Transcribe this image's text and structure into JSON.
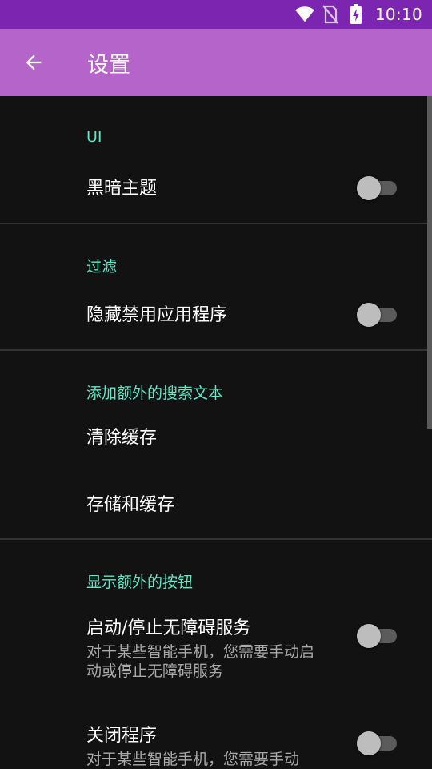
{
  "status_bar": {
    "time": "10:10",
    "icons": [
      "wifi-icon",
      "no-sim-icon",
      "battery-charging-icon"
    ]
  },
  "app_bar": {
    "back_icon": "arrow-back-icon",
    "title": "设置"
  },
  "sections": [
    {
      "category": "UI",
      "items": [
        {
          "title": "黑暗主题",
          "type": "switch",
          "checked": false
        }
      ]
    },
    {
      "category": "过滤",
      "items": [
        {
          "title": "隐藏禁用应用程序",
          "type": "switch",
          "checked": false
        }
      ]
    },
    {
      "category": "添加额外的搜索文本",
      "items": [
        {
          "title": "清除缓存",
          "type": "action"
        },
        {
          "title": "存储和缓存",
          "type": "action"
        }
      ]
    },
    {
      "category": "显示额外的按钮",
      "items": [
        {
          "title": "启动/停止无障碍服务",
          "summary": "对于某些智能手机，您需要手动启动或停止无障碍服务",
          "type": "switch",
          "checked": false
        },
        {
          "title": "关闭程序",
          "summary": "对于某些智能手机，您需要手动",
          "type": "switch",
          "checked": false
        }
      ]
    }
  ],
  "colors": {
    "status_bar": "#7b25b0",
    "app_bar": "#b565c9",
    "background": "#121212",
    "category_text": "#5ee7c4",
    "divider": "#333333"
  }
}
